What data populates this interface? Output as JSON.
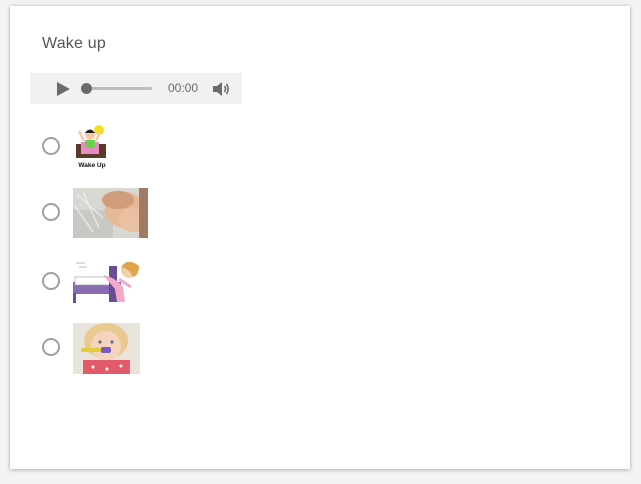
{
  "question": {
    "title": "Wake up"
  },
  "audio": {
    "time": "00:00",
    "play_icon": "play-icon",
    "volume_icon": "volume-icon",
    "progress": 0
  },
  "options": [
    {
      "icon": "wake-up-cartoon-image",
      "image_text": "Wake Up",
      "selected": false
    },
    {
      "icon": "washing-face-photo",
      "selected": false
    },
    {
      "icon": "getting-out-of-bed-cartoon-image",
      "selected": false
    },
    {
      "icon": "child-brushing-teeth-photo",
      "selected": false
    }
  ],
  "colors": {
    "card_bg": "#ffffff",
    "player_bg": "#f1f1f1",
    "radio_border": "#a0a0a0",
    "text": "#555555"
  }
}
